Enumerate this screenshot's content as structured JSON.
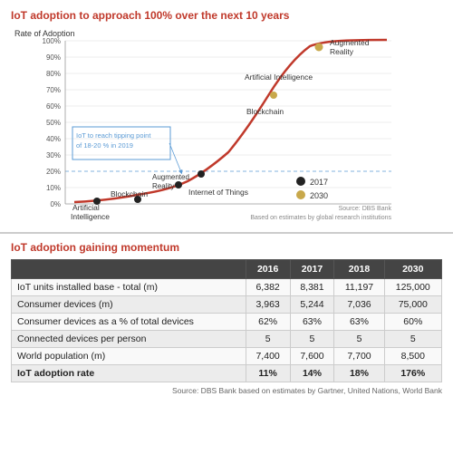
{
  "chart": {
    "title": "IoT adoption to approach 100% over the next 10 years",
    "y_axis_label": "Rate of Adoption",
    "y_ticks": [
      "100%",
      "90%",
      "80%",
      "70%",
      "60%",
      "50%",
      "40%",
      "30%",
      "20%",
      "10%",
      "0%"
    ],
    "annotation_tipping": "IoT to reach tipping point\nof 18-20% in 2019",
    "source": "Source: DBS Bank\nBased on estimates by global research institutions",
    "legend": [
      {
        "year": "2017",
        "color": "#222"
      },
      {
        "year": "2030",
        "color": "#c8a84b"
      }
    ],
    "labels": {
      "artificial_intelligence": "Artificial Intelligence",
      "augmented_reality": "Augmented\nReality",
      "blockchain": "Blockchain",
      "iot": "Internet of Things",
      "augmented_reality_2017": "Augmented\nReality",
      "blockchain_2017": "Blockchain",
      "ai_2017": "Artificial\nIntelligence"
    }
  },
  "table": {
    "title": "IoT adoption gaining momentum",
    "columns": [
      "",
      "2016",
      "2017",
      "2018",
      "2030"
    ],
    "rows": [
      {
        "label": "IoT units installed base - total (m)",
        "values": [
          "6,382",
          "8,381",
          "11,197",
          "125,000"
        ]
      },
      {
        "label": "Consumer devices (m)",
        "values": [
          "3,963",
          "5,244",
          "7,036",
          "75,000"
        ]
      },
      {
        "label": "Consumer devices as a % of total devices",
        "values": [
          "62%",
          "63%",
          "63%",
          "60%"
        ]
      },
      {
        "label": "Connected devices per person",
        "values": [
          "5",
          "5",
          "5",
          "5"
        ]
      },
      {
        "label": "World population (m)",
        "values": [
          "7,400",
          "7,600",
          "7,700",
          "8,500"
        ]
      },
      {
        "label": "IoT adoption rate",
        "values": [
          "11%",
          "14%",
          "18%",
          "176%"
        ]
      }
    ],
    "source": "Source: DBS Bank based on estimates by Gartner, United Nations, World Bank"
  }
}
